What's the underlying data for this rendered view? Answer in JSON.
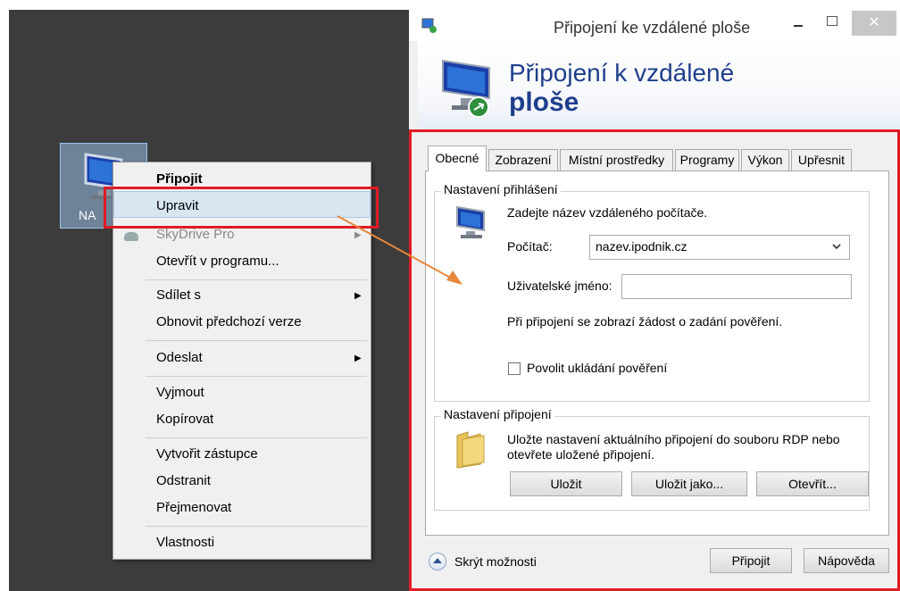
{
  "desktop": {
    "icon_label": "NA"
  },
  "context_menu": {
    "items": [
      {
        "label": "Připojit",
        "bold": true
      },
      {
        "label": "Upravit",
        "highlighted": true
      },
      {
        "label": "SkyDrive Pro",
        "disabled": true,
        "submenu": true
      },
      {
        "label": "Otevřít v programu..."
      },
      {
        "label": "Sdílet s",
        "submenu": true
      },
      {
        "label": "Obnovit předchozí verze"
      },
      {
        "label": "Odeslat",
        "submenu": true
      },
      {
        "label": "Vyjmout"
      },
      {
        "label": "Kopírovat"
      },
      {
        "label": "Vytvořit zástupce"
      },
      {
        "label": "Odstranit"
      },
      {
        "label": "Přejmenovat"
      },
      {
        "label": "Vlastnosti"
      }
    ],
    "submenu_glyph": "▶"
  },
  "rdp": {
    "title": "Připojení ke vzdálené ploše",
    "close_glyph": "✕",
    "banner_line1": "Připojení k vzdálené",
    "banner_line2": "ploše",
    "tabs": [
      "Obecné",
      "Zobrazení",
      "Místní prostředky",
      "Programy",
      "Výkon",
      "Upřesnit"
    ],
    "active_tab": 0,
    "login_group": {
      "legend": "Nastavení přihlášení",
      "instruction": "Zadejte název vzdáleného počítače.",
      "computer_label": "Počítač:",
      "computer_value": "nazev.ipodnik.cz",
      "username_label": "Uživatelské jméno:",
      "username_value": "",
      "note": "Při připojení se zobrazí žádost o zadání pověření.",
      "save_credentials_label": "Povolit ukládání pověření",
      "save_credentials_checked": false
    },
    "connection_group": {
      "legend": "Nastavení připojení",
      "text_line1": "Uložte nastavení aktuálního připojení do souboru RDP nebo",
      "text_line2": "otevřete uložené připojení.",
      "save_button": "Uložit",
      "save_as_button": "Uložit jako...",
      "open_button": "Otevřít..."
    },
    "hide_options": "Skrýt možnosti",
    "connect_button": "Připojit",
    "help_button": "Nápověda"
  },
  "colors": {
    "highlight_red": "#e01b24",
    "arrow_orange": "#e8863a",
    "banner_text": "#1f3f8c",
    "desktop_bg": "#3c3c3c"
  }
}
